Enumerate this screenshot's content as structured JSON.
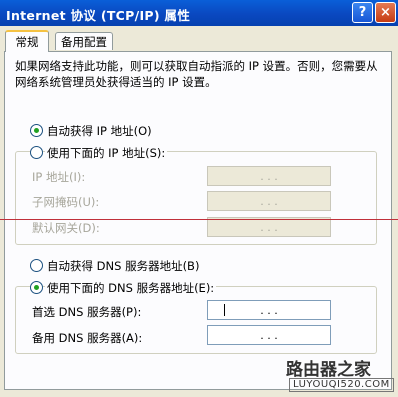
{
  "window": {
    "title": "Internet 协议 (TCP/IP) 属性",
    "help_label": "?",
    "close_label": "×"
  },
  "tabs": [
    {
      "label": "常规",
      "active": true
    },
    {
      "label": "备用配置",
      "active": false
    }
  ],
  "intro_text": "如果网络支持此功能，则可以获取自动指派的 IP 设置。否则，您需要从网络系统管理员处获得适当的 IP 设置。",
  "ip_section": {
    "auto_label": "自动获得 IP 地址(O)",
    "auto_selected": true,
    "manual_label": "使用下面的 IP 地址(S):",
    "manual_selected": false,
    "fields": [
      {
        "label": "IP 地址(I):",
        "value": ". . ."
      },
      {
        "label": "子网掩码(U):",
        "value": ". . ."
      },
      {
        "label": "默认网关(D):",
        "value": ". . ."
      }
    ]
  },
  "dns_section": {
    "auto_label": "自动获得 DNS 服务器地址(B)",
    "auto_selected": false,
    "manual_label": "使用下面的 DNS 服务器地址(E):",
    "manual_selected": true,
    "fields": [
      {
        "label": "首选 DNS 服务器(P):",
        "value": ". . ."
      },
      {
        "label": "备用 DNS 服务器(A):",
        "value": ". . ."
      }
    ]
  },
  "watermark": {
    "name": "路由器之家",
    "url": "LUYOUQI520.COM"
  },
  "colors": {
    "titlebar": "#0a48c0",
    "radio_selected": "#21a121",
    "tab_highlight": "#f5c242"
  }
}
